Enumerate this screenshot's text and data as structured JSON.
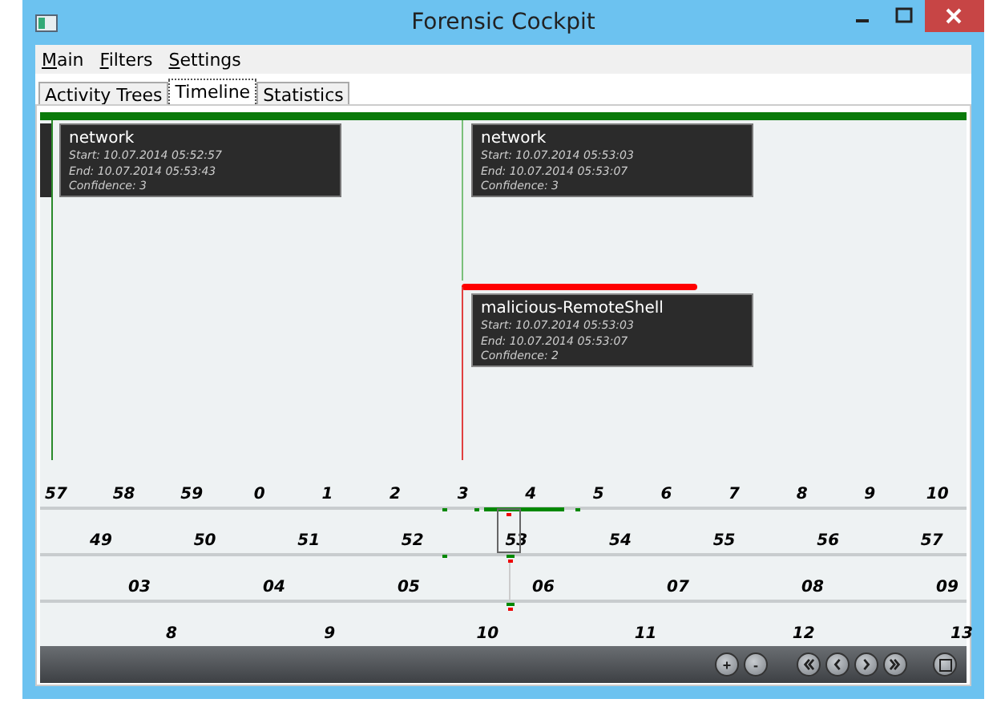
{
  "window": {
    "title": "Forensic Cockpit"
  },
  "menu": [
    {
      "label": "Main"
    },
    {
      "label": "Filters"
    },
    {
      "label": "Settings"
    }
  ],
  "tabs": [
    {
      "label": "Activity Trees",
      "selected": false
    },
    {
      "label": "Timeline",
      "selected": true
    },
    {
      "label": "Statistics",
      "selected": false
    }
  ],
  "events": [
    {
      "title": "network",
      "start": "Start: 10.07.2014 05:52:57",
      "end": "End: 10.07.2014 05:53:43",
      "confidence": "Confidence: 3",
      "malicious": false
    },
    {
      "title": "network",
      "start": "Start: 10.07.2014 05:53:03",
      "end": "End: 10.07.2014 05:53:07",
      "confidence": "Confidence: 3",
      "malicious": false
    },
    {
      "title": "malicious-RemoteShell",
      "start": "Start: 10.07.2014 05:53:03",
      "end": "End: 10.07.2014 05:53:07",
      "confidence": "Confidence: 2",
      "malicious": true
    }
  ],
  "scales": [
    {
      "labels": [
        "57",
        "58",
        "59",
        "0",
        "1",
        "2",
        "3",
        "4",
        "5",
        "6",
        "7",
        "8",
        "9",
        "10"
      ]
    },
    {
      "labels": [
        "49",
        "50",
        "51",
        "52",
        "53",
        "54",
        "55",
        "56",
        "57"
      ]
    },
    {
      "labels": [
        "03",
        "04",
        "05",
        "06",
        "07",
        "08",
        "09"
      ]
    },
    {
      "labels": [
        "8",
        "9",
        "10",
        "11",
        "12",
        "13"
      ]
    }
  ],
  "toolbar": {
    "zoom": [
      {
        "label": "+"
      },
      {
        "label": "-"
      }
    ]
  }
}
